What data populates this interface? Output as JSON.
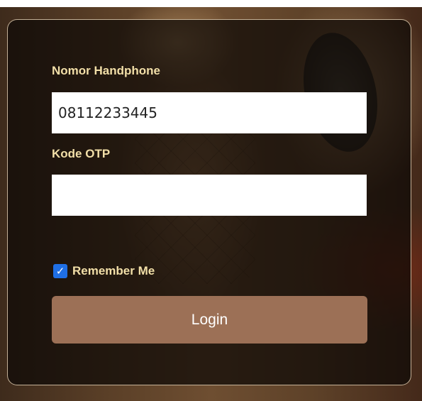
{
  "form": {
    "phone_label": "Nomor Handphone",
    "phone_value": "08112233445",
    "otp_label": "Kode OTP",
    "otp_value": "",
    "remember_label": "Remember Me",
    "remember_checked": true,
    "login_label": "Login"
  },
  "colors": {
    "label_color": "#f2dfa8",
    "button_color": "#9c7056",
    "checkbox_color": "#1f6fe5",
    "panel_overlay": "#0c0906"
  },
  "icons": {
    "checkbox": "checkmark-icon"
  }
}
